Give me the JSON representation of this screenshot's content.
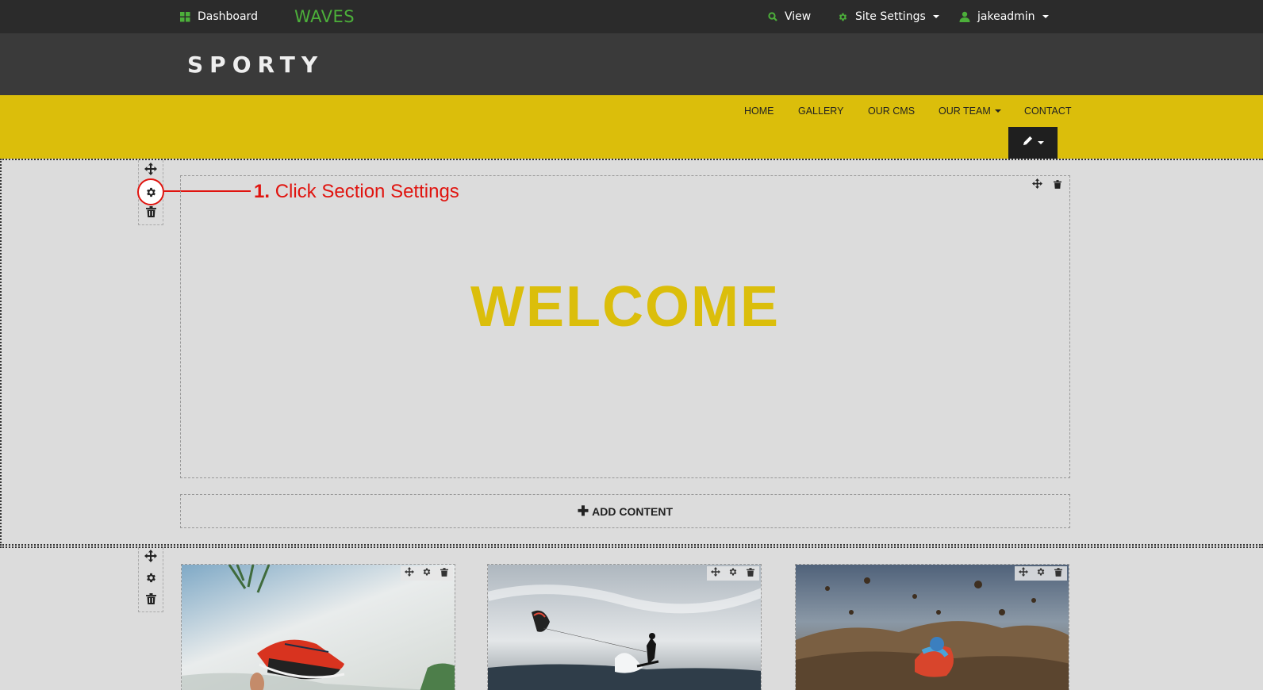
{
  "admin_bar": {
    "dashboard_label": "Dashboard",
    "brand": "WAVES",
    "view_label": "View",
    "site_settings_label": "Site Settings",
    "user_label": "jakeadmin"
  },
  "site": {
    "logo_text": "SPORTY"
  },
  "nav": {
    "items": [
      {
        "label": "HOME"
      },
      {
        "label": "GALLERY"
      },
      {
        "label": "OUR CMS"
      },
      {
        "label": "OUR TEAM"
      },
      {
        "label": "CONTACT"
      }
    ]
  },
  "hero": {
    "heading": "WELCOME"
  },
  "add_content": {
    "label": "ADD CONTENT"
  },
  "annotation": {
    "step": "1.",
    "text": "Click Section Settings"
  },
  "icons": {
    "dashboard": "grid-icon",
    "view": "search-icon",
    "site_settings": "gear-icon",
    "user": "user-icon",
    "edit": "pencil-icon",
    "move": "move-icon",
    "settings": "gear-icon",
    "delete": "trash-icon"
  },
  "colors": {
    "admin_bg": "#2b2b2b",
    "accent_green": "#4caf3a",
    "header_bg": "#3a3a3a",
    "nav_yellow": "#dbbe0b",
    "annotation_red": "#e0140f",
    "canvas_bg": "#dcdcdc"
  }
}
